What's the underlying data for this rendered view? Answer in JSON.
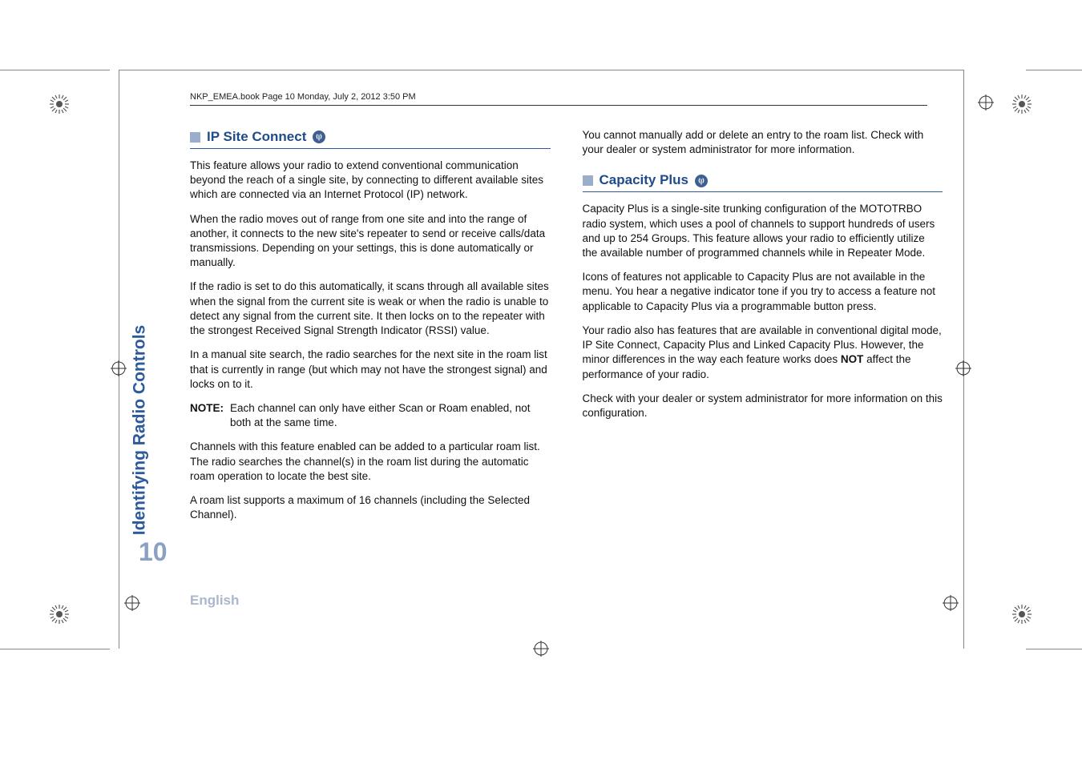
{
  "header": "NKP_EMEA.book  Page 10  Monday, July 2, 2012  3:50 PM",
  "sideLabel": "Identifying Radio Controls",
  "pageNumber": "10",
  "language": "English",
  "left": {
    "heading": "IP Site Connect",
    "p1": "This feature allows your radio to extend conventional communication beyond the reach of a single site, by connecting to different available sites which are connected via an Internet Protocol (IP) network.",
    "p2": "When the radio moves out of range from one site and into the range of another, it connects to the new site's repeater to send or receive calls/data transmissions. Depending on your settings, this is done automatically or manually.",
    "p3": "If the radio is set to do this automatically, it scans through all available sites when the signal from the current site is weak or when the radio is unable to detect any signal from the current site. It then locks on to the repeater with the strongest Received Signal Strength Indicator (RSSI) value.",
    "p4": "In a manual site search, the radio searches for the next site in the roam list that is currently in range (but which may not have the strongest signal) and locks on to it.",
    "noteLabel": "NOTE:",
    "noteText": "Each channel can only have either Scan or Roam enabled, not both at the same time.",
    "p5": "Channels with this feature enabled can be added to a particular roam list. The radio searches the channel(s) in the roam list during the automatic roam operation to locate the best site.",
    "p6": "A roam list supports a maximum of 16 channels (including the Selected Channel)."
  },
  "right": {
    "p0": "You cannot manually add or delete an entry to the roam list. Check with your dealer or system administrator for more information.",
    "heading": "Capacity Plus",
    "p1": "Capacity Plus is a single-site trunking configuration of the MOTOTRBO radio system, which uses a pool of channels to support hundreds of users and up to 254 Groups. This feature allows your radio to efficiently utilize the available number of programmed channels while in Repeater Mode.",
    "p2": "Icons of features not applicable to Capacity Plus are not available in the menu. You hear a negative indicator tone if you try to access a feature not applicable to Capacity Plus via a programmable button press.",
    "p3a": "Your radio also has features that are available in conventional digital mode, IP Site Connect, Capacity Plus and Linked Capacity Plus. However, the minor differences in the way each feature works does ",
    "p3bold": "NOT",
    "p3b": " affect the performance of your radio.",
    "p4": "Check with your dealer or system administrator for more information on this configuration."
  }
}
